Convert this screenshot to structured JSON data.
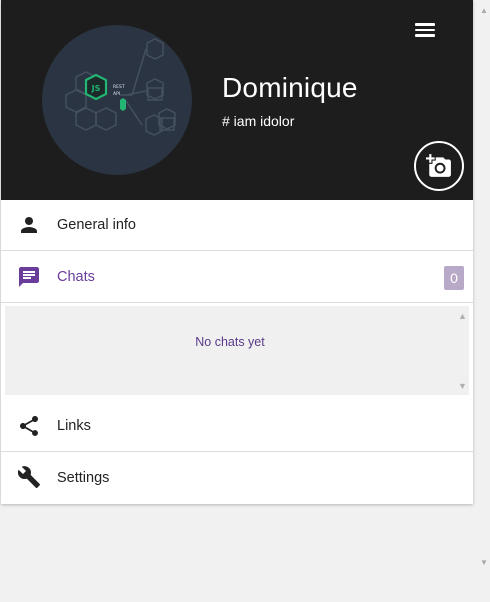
{
  "profile": {
    "name": "Dominique",
    "tag": "# iam idolor"
  },
  "avatar": {
    "description": "node-js-rest-api-graphic",
    "texts": [
      "JS",
      "REST",
      "API"
    ]
  },
  "menu": {
    "general_info": "General info",
    "chats": "Chats",
    "chats_count": "0",
    "links": "Links",
    "settings": "Settings"
  },
  "chats_panel": {
    "empty_text": "No chats yet"
  },
  "colors": {
    "header_bg": "#1d1d1d",
    "accent": "#6a3d9a",
    "badge_bg": "#b9a9c9",
    "avatar_bg": "#2b3443",
    "node_green": "#22b573"
  },
  "icons": {
    "menu": "hamburger-menu-icon",
    "camera": "add-photo-camera-icon",
    "general_info": "person-icon",
    "chats": "chat-bubble-icon",
    "links": "share-icon",
    "settings": "wrench-icon"
  }
}
